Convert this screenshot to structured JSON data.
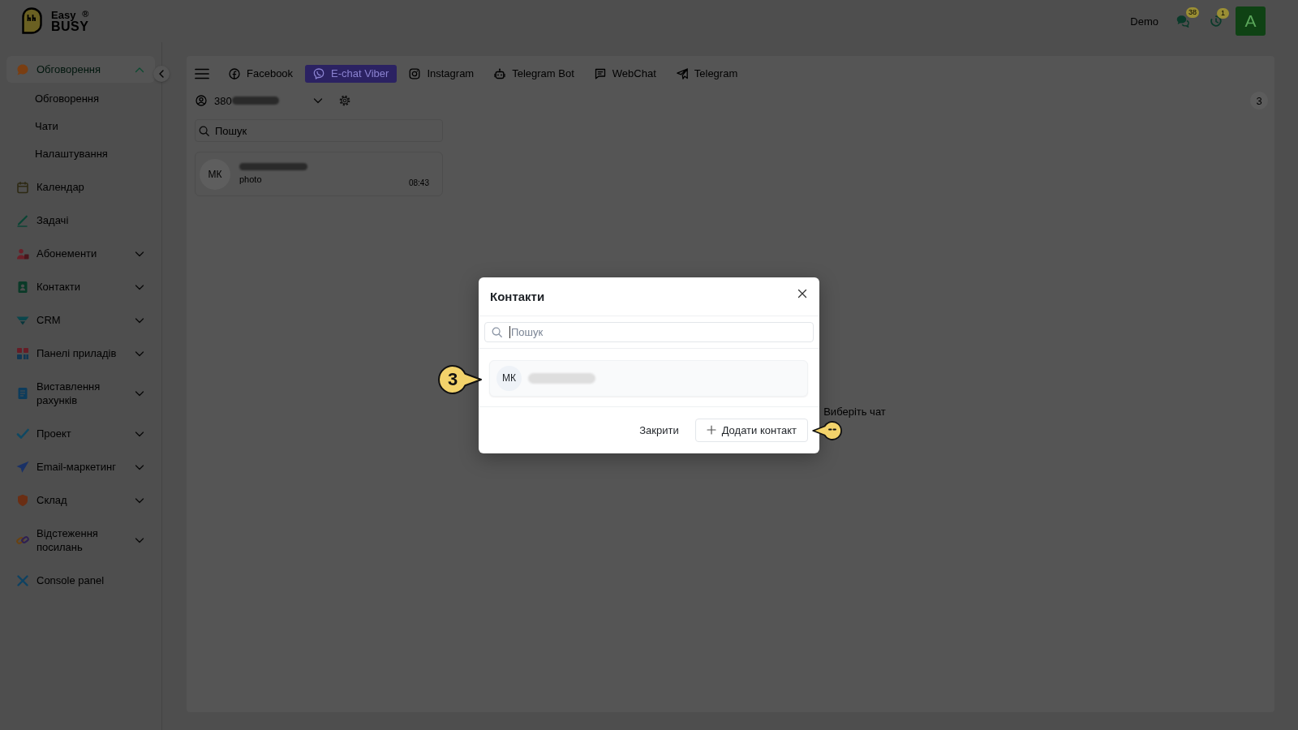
{
  "logo": {
    "line_1": "Easy",
    "line_2": "BUSY",
    "mark": "®"
  },
  "header": {
    "workspace": "Demo",
    "notifications": [
      {
        "count": "38"
      },
      {
        "count": "1"
      }
    ],
    "avatar": {
      "initial": "A"
    }
  },
  "sidebar": {
    "items": [
      {
        "kind": "group",
        "label": "Обговорення",
        "selected": true,
        "expanded": true,
        "children": [
          {
            "label": "Обговорення",
            "selected": false
          },
          {
            "label": "Чати",
            "selected": false
          },
          {
            "label": "Налаштування",
            "selected": false
          }
        ]
      },
      {
        "kind": "link",
        "label": "Календар",
        "selected": false
      },
      {
        "kind": "link",
        "label": "Задачі",
        "selected": false
      },
      {
        "kind": "group",
        "label": "Абонементи",
        "selected": false,
        "expanded": false
      },
      {
        "kind": "group",
        "label": "Контакти",
        "selected": false,
        "expanded": false
      },
      {
        "kind": "group",
        "label": "CRM",
        "selected": false,
        "expanded": false
      },
      {
        "kind": "group",
        "label": "Панелі приладів",
        "selected": false,
        "expanded": false
      },
      {
        "kind": "group",
        "label": "Виставлення рахунків",
        "selected": false,
        "expanded": false
      },
      {
        "kind": "group",
        "label": "Проект",
        "selected": false,
        "expanded": false
      },
      {
        "kind": "group",
        "label": "Email-маркетинг",
        "selected": false,
        "expanded": false
      },
      {
        "kind": "group",
        "label": "Склад",
        "selected": false,
        "expanded": false
      },
      {
        "kind": "group",
        "label": "Відстеження посилань",
        "selected": false,
        "expanded": false
      },
      {
        "kind": "link",
        "label": "Console panel",
        "selected": false
      }
    ]
  },
  "toolbar": {
    "tabs": [
      {
        "label": "Facebook",
        "selected": false
      },
      {
        "label": "E-chat Viber",
        "selected": true
      },
      {
        "label": "Instagram",
        "selected": false
      },
      {
        "label": "Telegram Bot",
        "selected": false
      },
      {
        "label": "WebChat",
        "selected": false
      },
      {
        "label": "Telegram",
        "selected": false
      }
    ]
  },
  "account": {
    "phone_prefix": "380",
    "count": "3"
  },
  "chat_list": {
    "search": {
      "placeholder": "Пошук"
    },
    "chats": [
      {
        "initials": "МК",
        "preview": "photo",
        "time": "08:43"
      }
    ]
  },
  "chat_pane": {
    "empty_text": "Виберіть чат"
  },
  "dialog": {
    "title": "Контакти",
    "search": {
      "placeholder": "Пошук",
      "focused": true
    },
    "contacts": [
      {
        "initials": "МК"
      }
    ],
    "buttons": [
      {
        "kind": "plain",
        "label": "Закрити"
      },
      {
        "kind": "add",
        "label": "Додати контакт"
      }
    ]
  },
  "tour_markers": [
    {
      "kind": "step",
      "number": "3"
    },
    {
      "kind": "face"
    }
  ]
}
